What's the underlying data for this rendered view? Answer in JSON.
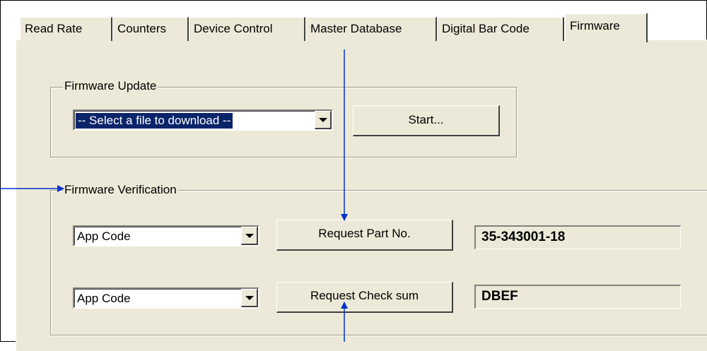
{
  "tabs": [
    {
      "label": "Read Rate"
    },
    {
      "label": "Counters"
    },
    {
      "label": "Device Control"
    },
    {
      "label": "Master Database"
    },
    {
      "label": "Digital Bar Code"
    },
    {
      "label": "Firmware",
      "active": true
    }
  ],
  "firmware_update": {
    "legend": "Firmware Update",
    "file_select_value": "-- Select a file to download --",
    "start_button": "Start..."
  },
  "firmware_verification": {
    "legend": "Firmware Verification",
    "part_no_select_value": "App Code",
    "part_no_button": "Request Part No.",
    "part_no_result": "35-343001-18",
    "checksum_select_value": "App Code",
    "checksum_button": "Request Check sum",
    "checksum_result": "DBEF"
  },
  "colors": {
    "panel": "#ece9d8",
    "selection": "#0a246a",
    "callout_arrow": "#0033cc"
  }
}
